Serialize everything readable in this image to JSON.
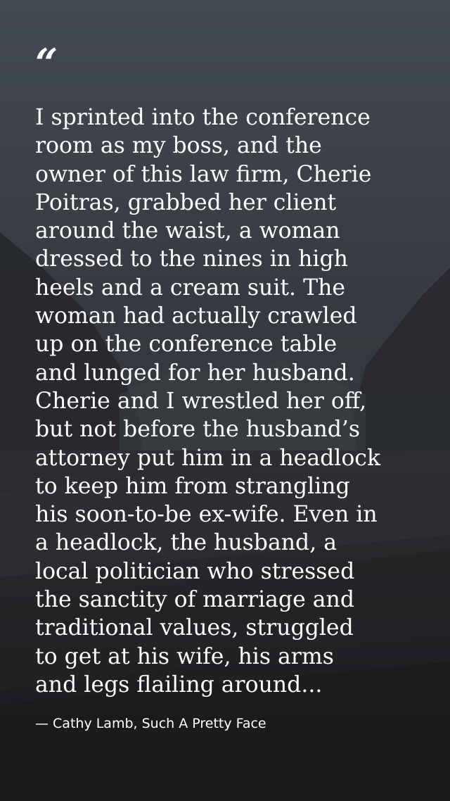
{
  "quote": {
    "mark": "“",
    "text": "I sprinted into the conference\nroom as my boss, and the\nowner of this law firm, Cherie\nPoitras, grabbed her client\naround the waist, a woman\ndressed to the nines in high\nheels and a cream suit. The\nwoman had actually crawled\nup on the conference table\nand lunged for her husband.\nCherie and I wrestled her off,\nbut not before the husband’s\nattorney put him in a headlock\nto keep him from strangling\nhis soon-to-be ex-wife. Even in\na headlock, the husband, a\nlocal politician who stressed\nthe sanctity of marriage and\ntraditional values, struggled\nto get at his wife, his arms\nand legs flailing around...",
    "attribution": "— Cathy Lamb, Such A Pretty Face"
  },
  "colors": {
    "text": "#ffffff",
    "background": "#2a2d31"
  }
}
